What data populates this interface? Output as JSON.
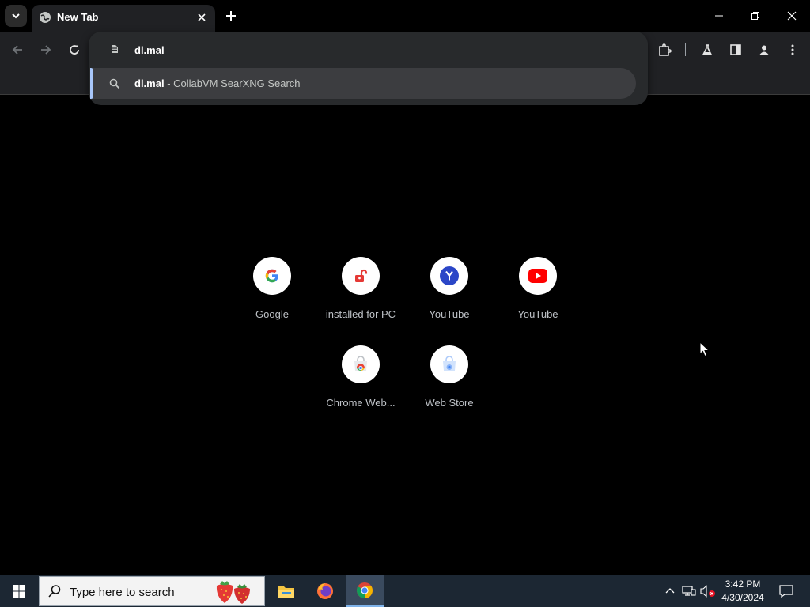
{
  "tab": {
    "title": "New Tab",
    "favicon": "globe-icon"
  },
  "omnibox": {
    "value": "dl.mal",
    "suggestion": {
      "query": "dl.mal",
      "separator": " - ",
      "engine": "CollabVM SearXNG Search"
    }
  },
  "shortcuts": [
    {
      "label": "Google",
      "icon": "google-icon"
    },
    {
      "label": "installed for PC",
      "icon": "unlocked-padlock-icon"
    },
    {
      "label": "YouTube",
      "icon": "y-letter-icon"
    },
    {
      "label": "YouTube",
      "icon": "youtube-icon"
    },
    {
      "label": "Chrome Web...",
      "icon": "chrome-web-store-icon"
    },
    {
      "label": "Web Store",
      "icon": "web-store-icon"
    }
  ],
  "taskbar": {
    "search_placeholder": "Type here to search",
    "clock_time": "3:42 PM",
    "clock_date": "4/30/2024",
    "apps": [
      "file-explorer-icon",
      "firefox-icon",
      "chrome-icon"
    ]
  },
  "colors": {
    "page_bg": "#000000",
    "toolbar_bg": "#202124",
    "omnibox_bg": "#282a2c",
    "suggestion_accent": "#a8c7fa",
    "taskbar_bg": "#1c2733",
    "youtube_red": "#ff0000",
    "y_badge_blue": "#2b46c7"
  }
}
